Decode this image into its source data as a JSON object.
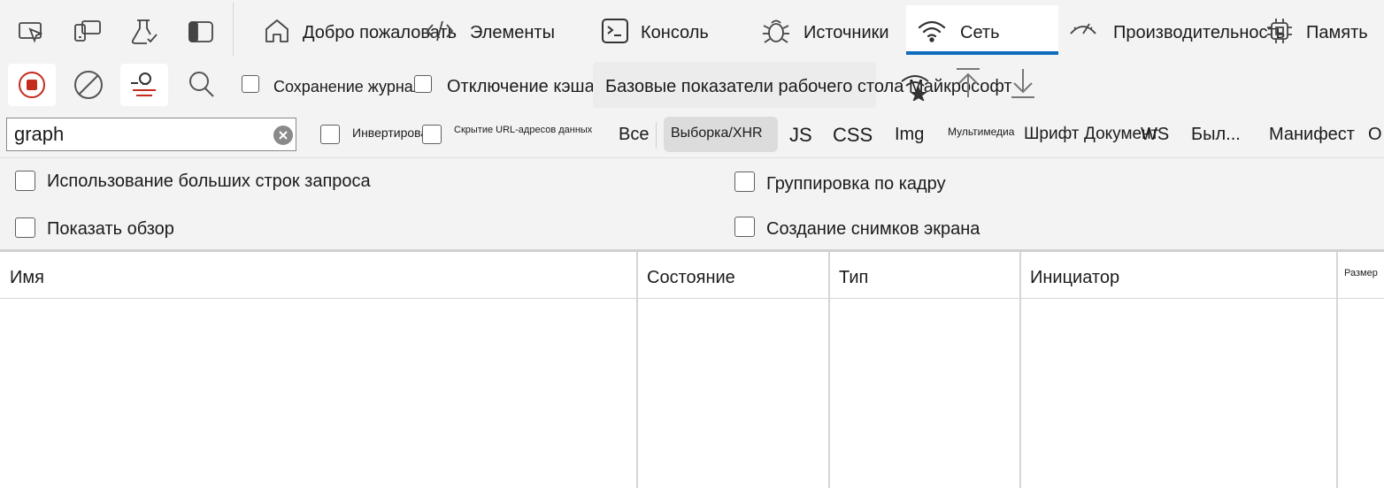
{
  "tabs": {
    "welcome": "Добро пожаловать",
    "elements": "Элементы",
    "console": "Консоль",
    "sources": "Источники",
    "network": "Сеть",
    "performance": "Производительность",
    "memory": "Память"
  },
  "toolbar": {
    "preserve_log_label": "Сохранение журнала",
    "disable_cache_label": "Отключение кэша",
    "throttling_value": "Базовые показатели рабочего стола Майкрософт"
  },
  "filter": {
    "value": "graph",
    "invert_label": "Инвертировать",
    "hide_data_urls_label": "Скрытие URL-адресов данных",
    "types": [
      "Все",
      "Выборка/XHR",
      "JS",
      "CSS",
      "Img",
      "Мультимедиа",
      "Шрифт",
      "Документ",
      "WS",
      "Был...",
      "Манифест",
      "О"
    ]
  },
  "options": {
    "large_rows_label": "Использование больших строк запроса",
    "show_overview_label": "Показать обзор",
    "group_by_frame_label": "Группировка по кадру",
    "capture_screenshots_label": "Создание снимков экрана"
  },
  "table": {
    "columns": [
      "Имя",
      "Состояние",
      "Тип",
      "Инициатор",
      "Размер"
    ]
  },
  "colors": {
    "accent": "#0f6cbd",
    "record": "#c42b1c",
    "panel_bg": "#f3f3f3"
  },
  "icons": [
    "inspect-icon",
    "device-emulation-icon",
    "experiments-icon",
    "dock-icon",
    "home-icon",
    "code-icon",
    "console-icon",
    "bug-icon",
    "wifi-icon",
    "gauge-icon",
    "chip-icon",
    "record-icon",
    "clear-icon",
    "filter-icon",
    "search-icon",
    "network-conditions-icon",
    "upload-icon",
    "download-icon",
    "clear-input-icon"
  ]
}
